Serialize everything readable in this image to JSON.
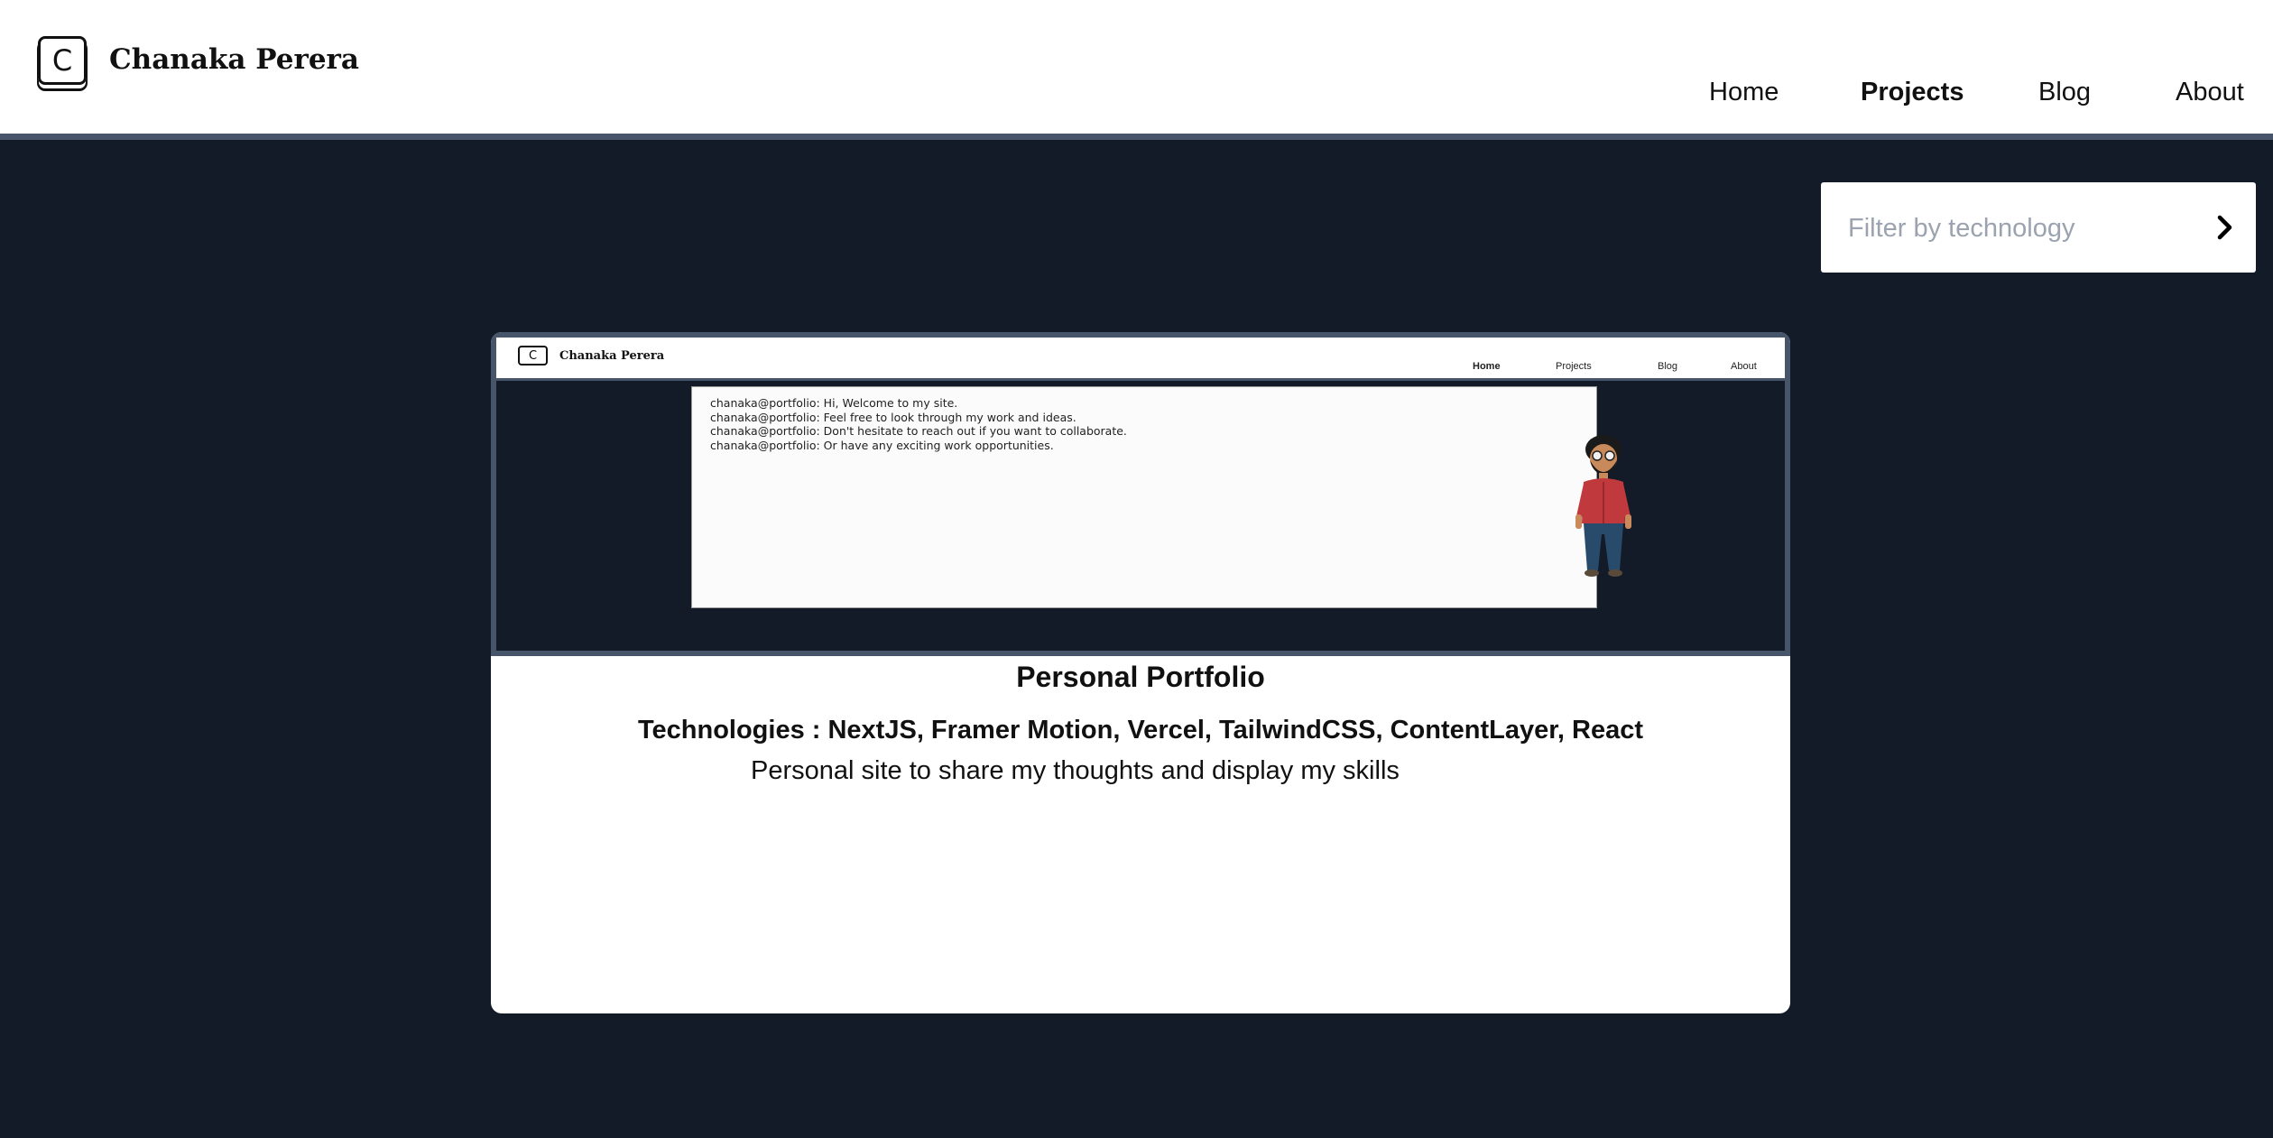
{
  "header": {
    "logo_letter": "C",
    "brand": "Chanaka Perera",
    "nav": [
      {
        "label": "Home",
        "active": false
      },
      {
        "label": "Projects",
        "active": true
      },
      {
        "label": "Blog",
        "active": false
      },
      {
        "label": "About",
        "active": false
      }
    ]
  },
  "filter": {
    "placeholder": "Filter by technology",
    "value": "",
    "button_icon": "chevron-right-icon"
  },
  "project": {
    "title": "Personal Portfolio",
    "technologies": "Technologies : NextJS, Framer Motion, Vercel, TailwindCSS, ContentLayer, React",
    "description": "Personal site to share my thoughts and display my skills",
    "screenshot": {
      "logo_letter": "C",
      "brand": "Chanaka Perera",
      "nav": [
        "Home",
        "Projects",
        "Blog",
        "About"
      ],
      "terminal_lines": [
        "chanaka@portfolio: Hi, Welcome to my site.",
        "chanaka@portfolio: Feel free to look through my work and ideas.",
        "chanaka@portfolio: Don't hesitate to reach out if you want to collaborate.",
        "chanaka@portfolio: Or have any exciting work opportunities."
      ]
    }
  },
  "colors": {
    "page_bg": "#131a28",
    "header_border": "#47556a",
    "card_bg": "#ffffff"
  }
}
